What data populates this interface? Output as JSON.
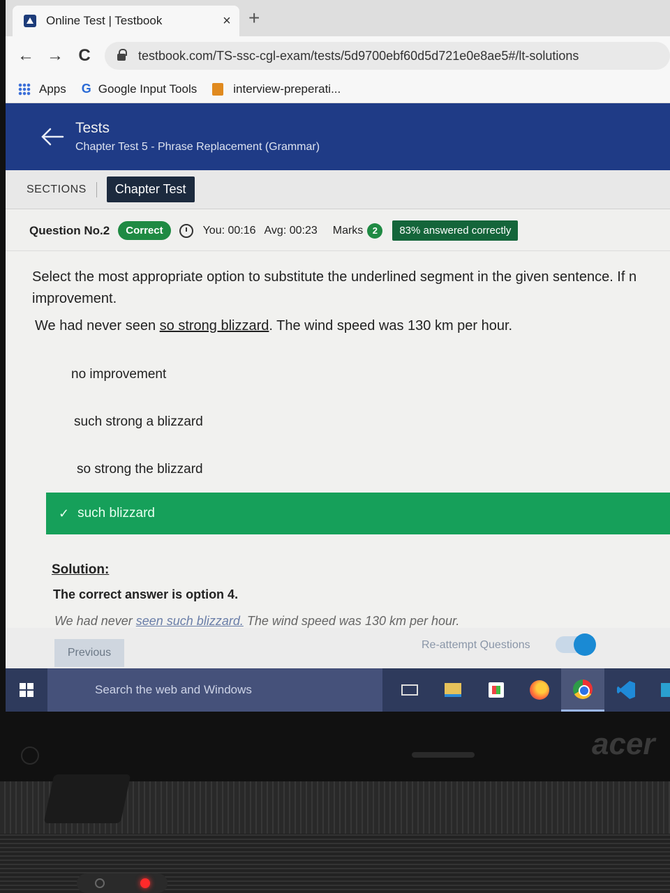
{
  "browser": {
    "tab_title": "Online Test | Testbook",
    "tab_close": "×",
    "new_tab": "+",
    "url": "testbook.com/TS-ssc-cgl-exam/tests/5d9700ebf60d5d721e0e8ae5#/lt-solutions",
    "nav": {
      "back": "←",
      "forward": "→",
      "reload": "C"
    },
    "bookmarks": [
      {
        "label": "Apps",
        "icon": "apps-grid-icon"
      },
      {
        "label": "Google Input Tools",
        "icon": "google-icon"
      },
      {
        "label": "interview-preperati...",
        "icon": "bookmark-folder-icon"
      }
    ]
  },
  "header": {
    "title": "Tests",
    "subtitle": "Chapter Test 5 - Phrase Replacement (Grammar)"
  },
  "sections": {
    "label": "SECTIONS",
    "active": "Chapter Test"
  },
  "question_bar": {
    "number": "Question No.2",
    "status": "Correct",
    "you_time": "You: 00:16",
    "avg_time": "Avg: 00:23",
    "marks_label": "Marks",
    "marks_value": "2",
    "answered": "83% answered correctly"
  },
  "question": {
    "instruction": "Select the most appropriate option to substitute the underlined segment in the given sentence. If n",
    "instruction_cont": "improvement.",
    "sentence_before": "We had never seen ",
    "sentence_underlined": "so strong blizzard",
    "sentence_after": ". The wind speed was 130 km per hour.",
    "options": [
      "no improvement",
      "such strong a blizzard",
      "so strong the blizzard",
      "such blizzard"
    ],
    "correct_index": 3,
    "check_mark": "✓"
  },
  "solution": {
    "title": "Solution:",
    "answer": "The correct answer is option 4.",
    "sentence_before": "We had never ",
    "sentence_underlined": "seen such blizzard.",
    "sentence_after": " The wind speed was 130 km per hour."
  },
  "footer": {
    "previous": "Previous",
    "reattempt": "Re-attempt Questions",
    "reattempt_on": true
  },
  "taskbar": {
    "search_placeholder": "Search the web and Windows"
  },
  "device": {
    "brand": "acer"
  },
  "colors": {
    "header_blue": "#1f3b86",
    "correct_green": "#16a05a",
    "badge_green": "#1f8a43"
  }
}
